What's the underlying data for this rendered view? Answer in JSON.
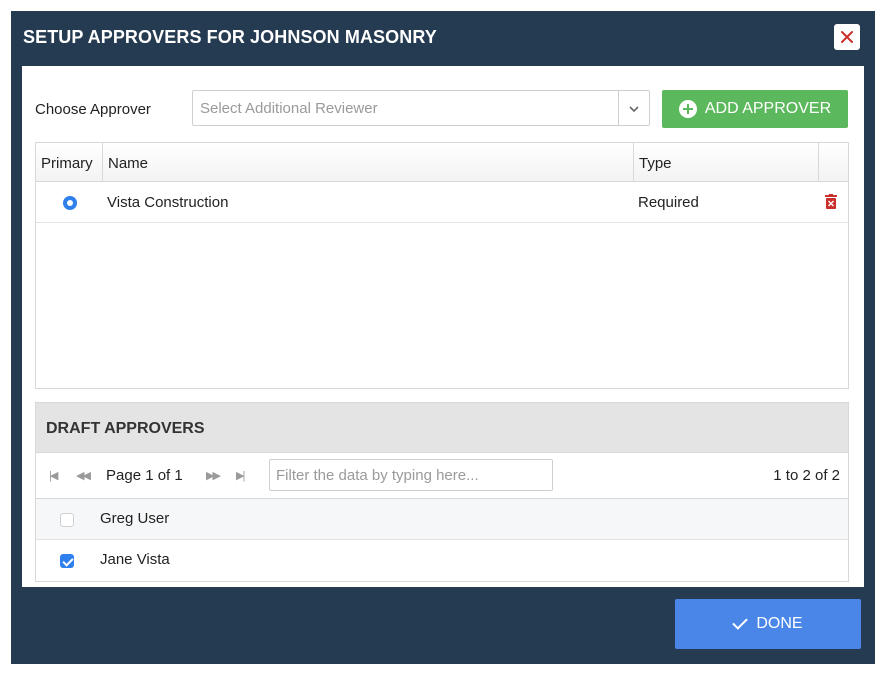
{
  "modal": {
    "title": "SETUP APPROVERS FOR JOHNSON MASONRY",
    "close_icon": "close-icon"
  },
  "chooser": {
    "label": "Choose Approver",
    "select_placeholder": "Select Additional Reviewer",
    "add_button_label": "ADD APPROVER"
  },
  "approvers_grid": {
    "columns": [
      "Primary",
      "Name",
      "Type"
    ],
    "rows": [
      {
        "primary": true,
        "name": "Vista Construction",
        "type": "Required"
      }
    ]
  },
  "draft_approvers": {
    "title": "DRAFT APPROVERS",
    "page_text": "Page 1 of 1",
    "filter_placeholder": "Filter the data by typing here...",
    "count_text": "1 to 2 of 2",
    "items": [
      {
        "name": "Greg User",
        "checked": false
      },
      {
        "name": "Jane Vista",
        "checked": true
      }
    ]
  },
  "footer": {
    "done_label": "DONE"
  },
  "colors": {
    "modal_bg": "#253b51",
    "add_button": "#5cb85c",
    "done_button": "#4a86e8",
    "delete_icon": "#c9302c",
    "accent_blue": "#2f80ed"
  }
}
